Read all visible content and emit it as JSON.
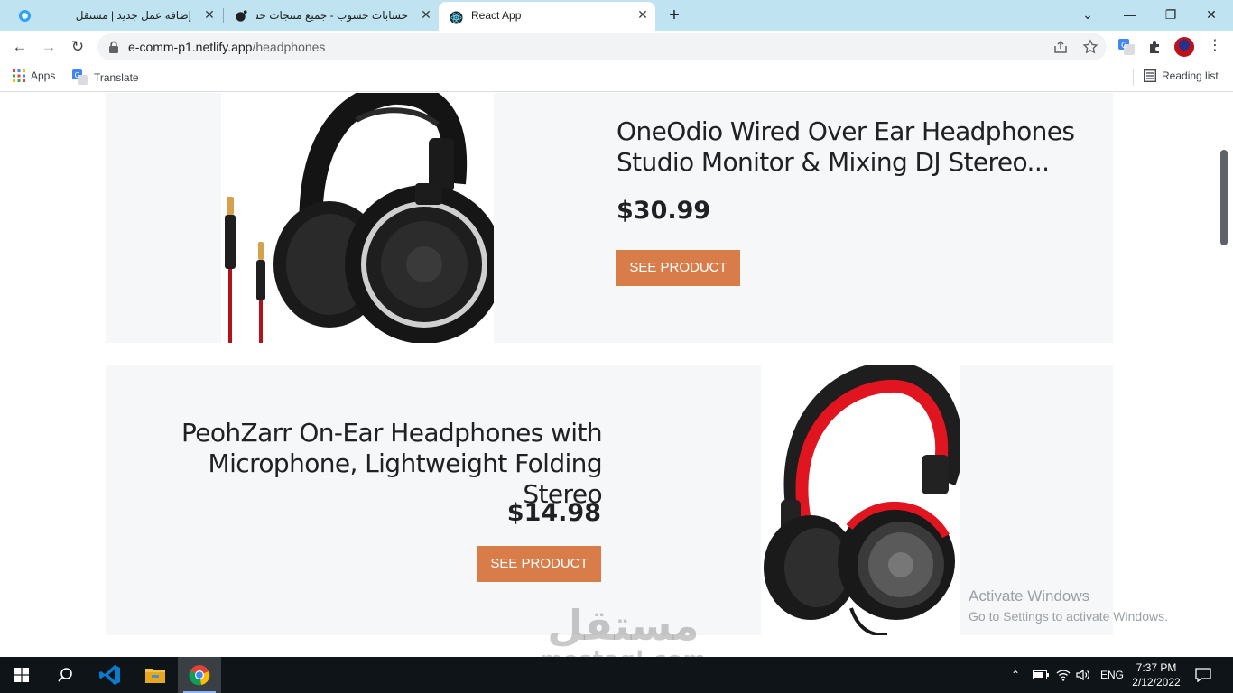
{
  "browser": {
    "tabs": [
      {
        "title": "إضافة عمل جديد | مستقل",
        "favicon": "mostaql-icon"
      },
      {
        "title": "حسابات حسوب - جميع منتجات حسوب",
        "favicon": "hsoub-icon"
      },
      {
        "title": "React App",
        "favicon": "react-icon",
        "active": true
      }
    ],
    "url_host": "e-comm-p1.netlify.app",
    "url_path": "/headphones",
    "bookmarks": [
      {
        "label": "Apps",
        "icon": "apps-grid-icon"
      },
      {
        "label": "Translate",
        "icon": "translate-icon"
      }
    ],
    "reading_list": "Reading list"
  },
  "products": [
    {
      "name": "OneOdio Wired Over Ear Headphones Studio Monitor & Mixing DJ Stereo...",
      "price": "$30.99",
      "button": "SEE PRODUCT",
      "image": "black-headphones-with-cable"
    },
    {
      "name": "PeohZarr On-Ear Headphones with Microphone, Lightweight Folding Stereo",
      "price": "$14.98",
      "button": "SEE PRODUCT",
      "image": "red-black-headphones"
    }
  ],
  "overlay": {
    "activate_title": "Activate Windows",
    "activate_sub": "Go to Settings to activate Windows.",
    "watermark_ar": "مستقل",
    "watermark_en": "mostaql.com"
  },
  "taskbar": {
    "language": "ENG",
    "time": "7:37 PM",
    "date": "2/12/2022",
    "apps": [
      "windows-start-icon",
      "search-icon",
      "vscode-icon",
      "file-explorer-icon",
      "chrome-icon"
    ]
  },
  "colors": {
    "accent_button": "#d87d4a",
    "card_bg": "#f6f7f9",
    "tab_strip": "#bfe3f0"
  }
}
